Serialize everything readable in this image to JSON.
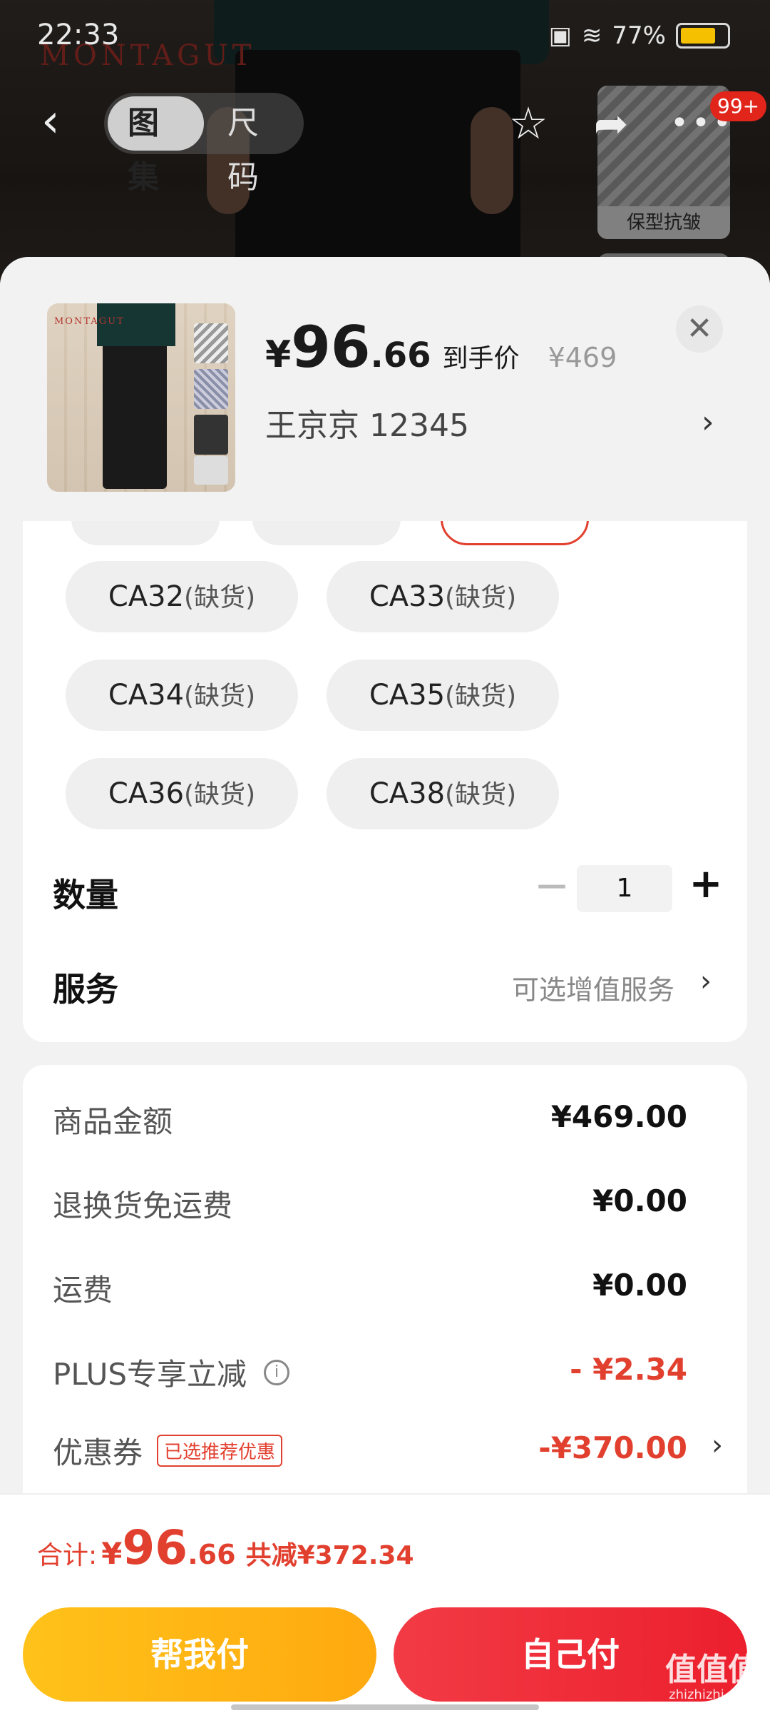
{
  "status_bar": {
    "time": "22:33",
    "battery": "77%"
  },
  "background": {
    "brand": "MONTAGUT",
    "feature_caption": "保型抗皱"
  },
  "nav": {
    "back": "‹",
    "tabs": [
      "图集",
      "尺码"
    ],
    "badge": "99+"
  },
  "product": {
    "currency": "¥",
    "price_int": "96",
    "price_dec": ".66",
    "price_tag": "到手价",
    "original_price": "¥469",
    "spec": "王京京  12345"
  },
  "sizes": [
    {
      "code": "CA32",
      "status": "(缺货)"
    },
    {
      "code": "CA33",
      "status": "(缺货)"
    },
    {
      "code": "CA34",
      "status": "(缺货)"
    },
    {
      "code": "CA35",
      "status": "(缺货)"
    },
    {
      "code": "CA36",
      "status": "(缺货)"
    },
    {
      "code": "CA38",
      "status": "(缺货)"
    }
  ],
  "quantity": {
    "label": "数量",
    "value": "1",
    "minus": "−",
    "plus": "+"
  },
  "service": {
    "label": "服务",
    "value": "可选增值服务"
  },
  "summary": [
    {
      "label": "商品金额",
      "value": "¥469.00"
    },
    {
      "label": "退换货免运费",
      "value": "¥0.00"
    },
    {
      "label": "运费",
      "value": "¥0.00"
    },
    {
      "label": "PLUS专享立减",
      "value": "- ¥2.34"
    },
    {
      "label": "优惠券",
      "tag": "已选推荐优惠",
      "value": "-¥370.00"
    }
  ],
  "total": {
    "label": "合计:",
    "currency": "¥",
    "int": "96",
    "dec": ".66",
    "saving": "共减¥372.34"
  },
  "buttons": {
    "help_pay": "帮我付",
    "self_pay": "自己付"
  },
  "watermark": {
    "main": "值值值",
    "sub": "zhizhizhi.com"
  },
  "colors": {
    "accent_red": "#e2402f",
    "pay_red": "#ec1f2d",
    "help_yellow": "#ffb514"
  }
}
